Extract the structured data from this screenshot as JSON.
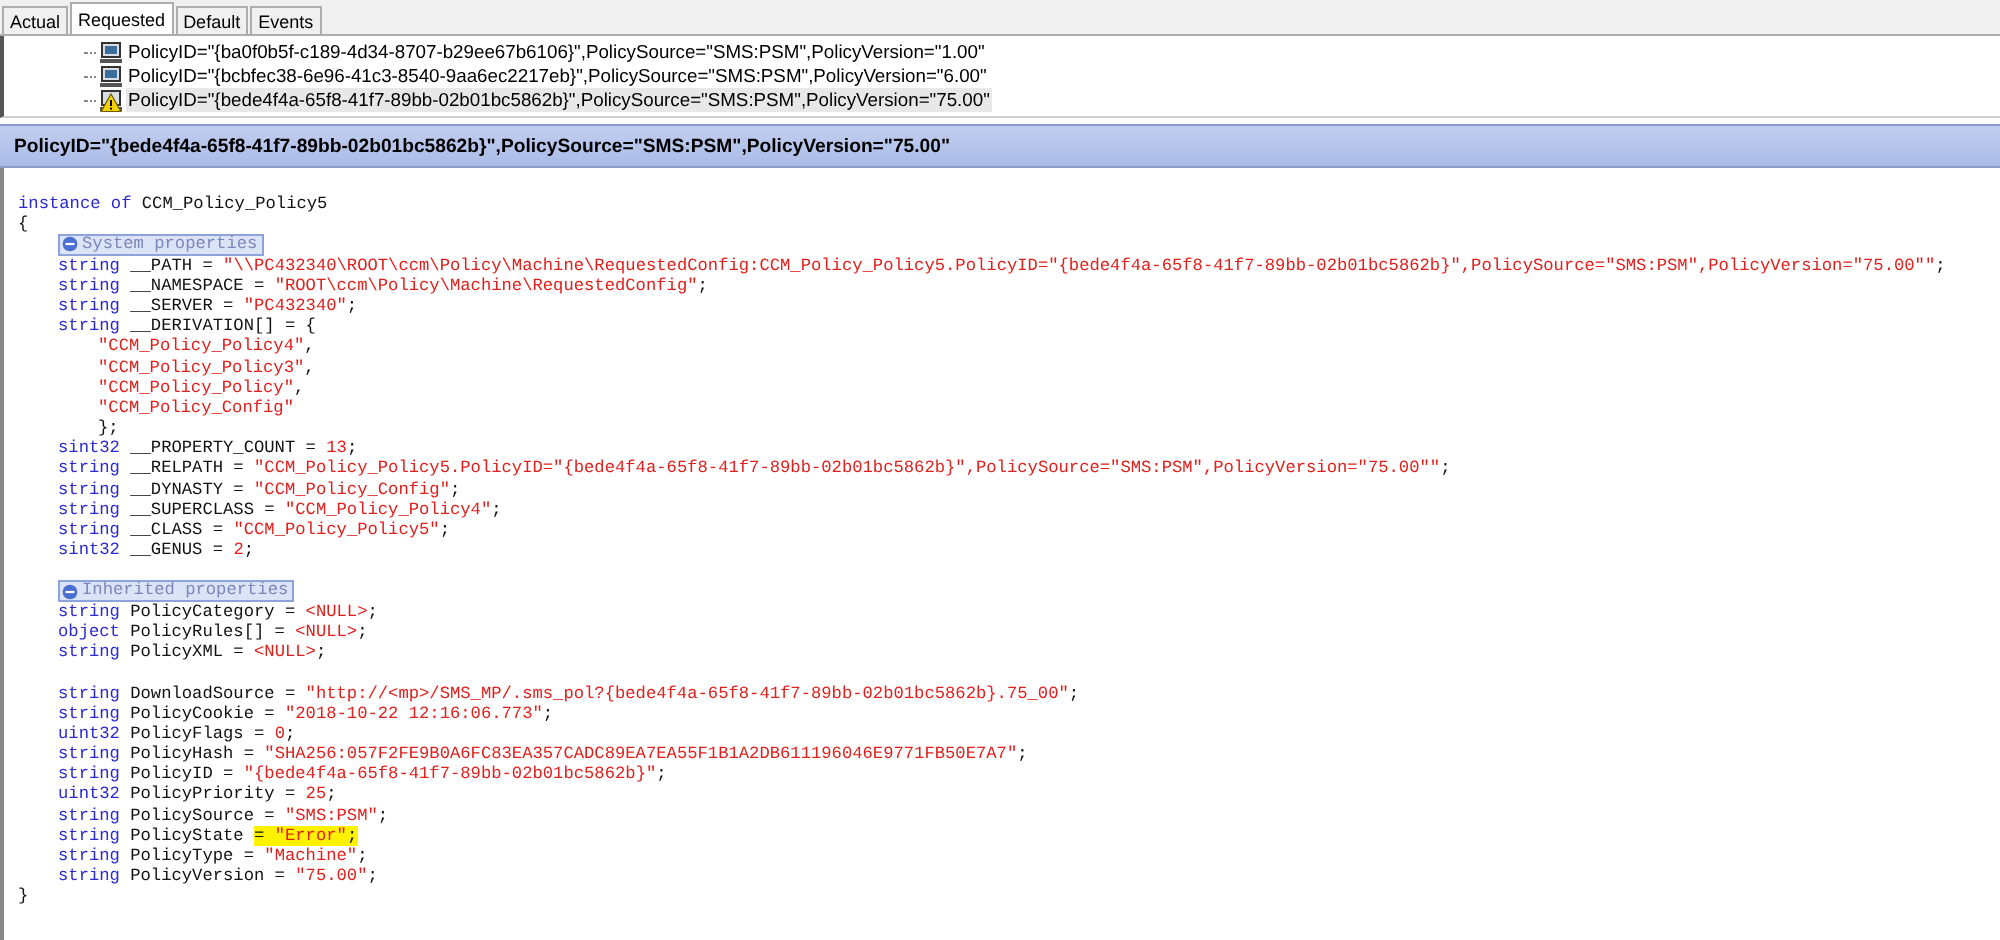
{
  "tabs": [
    {
      "label": "Actual",
      "selected": false
    },
    {
      "label": "Requested",
      "selected": true
    },
    {
      "label": "Default",
      "selected": false
    },
    {
      "label": "Events",
      "selected": false
    }
  ],
  "tree": {
    "items": [
      {
        "kind": "computer",
        "label": "PolicyID=\"{ba0f0b5f-c189-4d34-8707-b29ee67b6106}\",PolicySource=\"SMS:PSM\",PolicyVersion=\"1.00\"",
        "selected": false
      },
      {
        "kind": "computer",
        "label": "PolicyID=\"{bcbfec38-6e96-41c3-8540-9aa6ec2217eb}\",PolicySource=\"SMS:PSM\",PolicyVersion=\"6.00\"",
        "selected": false
      },
      {
        "kind": "warning",
        "label": "PolicyID=\"{bede4f4a-65f8-41f7-89bb-02b01bc5862b}\",PolicySource=\"SMS:PSM\",PolicyVersion=\"75.00\"",
        "selected": true
      }
    ]
  },
  "title_bar": {
    "title": "PolicyID=\"{bede4f4a-65f8-41f7-89bb-02b01bc5862b}\",PolicySource=\"SMS:PSM\",PolicyVersion=\"75.00\""
  },
  "code": {
    "lines": [
      {
        "kind": "code",
        "tokens": [
          {
            "kind": "keyword",
            "text": "instance of"
          },
          {
            "kind": "plain",
            "text": " CCM_Policy_Policy5"
          }
        ]
      },
      {
        "kind": "code",
        "tokens": [
          {
            "kind": "plain",
            "text": "{"
          }
        ]
      },
      {
        "kind": "section",
        "label": "System properties",
        "expanded": true,
        "children": [
          {
            "kind": "code",
            "tokens": [
              {
                "kind": "keyword",
                "text": "string"
              },
              {
                "kind": "plain",
                "text": " __PATH = "
              },
              {
                "kind": "literal",
                "text": "\"\\\\PC432340\\ROOT\\ccm\\Policy\\Machine\\RequestedConfig:CCM_Policy_Policy5.PolicyID=\"{bede4f4a-65f8-41f7-89bb-02b01bc5862b}\",PolicySource=\"SMS:PSM\",PolicyVersion=\"75.00\"\""
              },
              {
                "kind": "plain",
                "text": ";"
              }
            ]
          },
          {
            "kind": "code",
            "tokens": [
              {
                "kind": "keyword",
                "text": "string"
              },
              {
                "kind": "plain",
                "text": " __NAMESPACE = "
              },
              {
                "kind": "literal",
                "text": "\"ROOT\\ccm\\Policy\\Machine\\RequestedConfig\""
              },
              {
                "kind": "plain",
                "text": ";"
              }
            ]
          },
          {
            "kind": "code",
            "tokens": [
              {
                "kind": "keyword",
                "text": "string"
              },
              {
                "kind": "plain",
                "text": " __SERVER = "
              },
              {
                "kind": "literal",
                "text": "\"PC432340\""
              },
              {
                "kind": "plain",
                "text": ";"
              }
            ]
          },
          {
            "kind": "code",
            "tokens": [
              {
                "kind": "keyword",
                "text": "string"
              },
              {
                "kind": "plain",
                "text": " __DERIVATION[] = {"
              }
            ],
            "children": [
              {
                "kind": "code",
                "tokens": [
                  {
                    "kind": "literal",
                    "text": "\"CCM_Policy_Policy4\""
                  },
                  {
                    "kind": "plain",
                    "text": ","
                  }
                ]
              },
              {
                "kind": "code",
                "tokens": [
                  {
                    "kind": "literal",
                    "text": "\"CCM_Policy_Policy3\""
                  },
                  {
                    "kind": "plain",
                    "text": ","
                  }
                ]
              },
              {
                "kind": "code",
                "tokens": [
                  {
                    "kind": "literal",
                    "text": "\"CCM_Policy_Policy\""
                  },
                  {
                    "kind": "plain",
                    "text": ","
                  }
                ]
              },
              {
                "kind": "code",
                "tokens": [
                  {
                    "kind": "literal",
                    "text": "\"CCM_Policy_Config\""
                  }
                ]
              },
              {
                "kind": "code",
                "tokens": [
                  {
                    "kind": "plain",
                    "text": "};"
                  }
                ]
              }
            ]
          },
          {
            "kind": "code",
            "tokens": [
              {
                "kind": "keyword",
                "text": "sint32"
              },
              {
                "kind": "plain",
                "text": " __PROPERTY_COUNT = "
              },
              {
                "kind": "literal",
                "text": "13"
              },
              {
                "kind": "plain",
                "text": ";"
              }
            ]
          },
          {
            "kind": "code",
            "tokens": [
              {
                "kind": "keyword",
                "text": "string"
              },
              {
                "kind": "plain",
                "text": " __RELPATH = "
              },
              {
                "kind": "literal",
                "text": "\"CCM_Policy_Policy5.PolicyID=\"{bede4f4a-65f8-41f7-89bb-02b01bc5862b}\",PolicySource=\"SMS:PSM\",PolicyVersion=\"75.00\"\""
              },
              {
                "kind": "plain",
                "text": ";"
              }
            ]
          },
          {
            "kind": "code",
            "tokens": [
              {
                "kind": "keyword",
                "text": "string"
              },
              {
                "kind": "plain",
                "text": " __DYNASTY = "
              },
              {
                "kind": "literal",
                "text": "\"CCM_Policy_Config\""
              },
              {
                "kind": "plain",
                "text": ";"
              }
            ]
          },
          {
            "kind": "code",
            "tokens": [
              {
                "kind": "keyword",
                "text": "string"
              },
              {
                "kind": "plain",
                "text": " __SUPERCLASS = "
              },
              {
                "kind": "literal",
                "text": "\"CCM_Policy_Policy4\""
              },
              {
                "kind": "plain",
                "text": ";"
              }
            ]
          },
          {
            "kind": "code",
            "tokens": [
              {
                "kind": "keyword",
                "text": "string"
              },
              {
                "kind": "plain",
                "text": " __CLASS = "
              },
              {
                "kind": "literal",
                "text": "\"CCM_Policy_Policy5\""
              },
              {
                "kind": "plain",
                "text": ";"
              }
            ]
          },
          {
            "kind": "code",
            "tokens": [
              {
                "kind": "keyword",
                "text": "sint32"
              },
              {
                "kind": "plain",
                "text": " __GENUS = "
              },
              {
                "kind": "literal",
                "text": "2"
              },
              {
                "kind": "plain",
                "text": ";"
              }
            ]
          }
        ]
      },
      {
        "kind": "blank"
      },
      {
        "kind": "section",
        "label": "Inherited properties",
        "expanded": true,
        "children": [
          {
            "kind": "code",
            "tokens": [
              {
                "kind": "keyword",
                "text": "string"
              },
              {
                "kind": "plain",
                "text": " PolicyCategory = "
              },
              {
                "kind": "literal",
                "text": "<NULL>"
              },
              {
                "kind": "plain",
                "text": ";"
              }
            ]
          },
          {
            "kind": "code",
            "tokens": [
              {
                "kind": "keyword",
                "text": "object"
              },
              {
                "kind": "plain",
                "text": " PolicyRules[] = "
              },
              {
                "kind": "literal",
                "text": "<NULL>"
              },
              {
                "kind": "plain",
                "text": ";"
              }
            ]
          },
          {
            "kind": "code",
            "tokens": [
              {
                "kind": "keyword",
                "text": "string"
              },
              {
                "kind": "plain",
                "text": " PolicyXML = "
              },
              {
                "kind": "literal",
                "text": "<NULL>"
              },
              {
                "kind": "plain",
                "text": ";"
              }
            ]
          },
          {
            "kind": "blank"
          },
          {
            "kind": "code",
            "tokens": [
              {
                "kind": "keyword",
                "text": "string"
              },
              {
                "kind": "plain",
                "text": " DownloadSource = "
              },
              {
                "kind": "literal",
                "text": "\"http://<mp>/SMS_MP/.sms_pol?{bede4f4a-65f8-41f7-89bb-02b01bc5862b}.75_00\""
              },
              {
                "kind": "plain",
                "text": ";"
              }
            ]
          },
          {
            "kind": "code",
            "tokens": [
              {
                "kind": "keyword",
                "text": "string"
              },
              {
                "kind": "plain",
                "text": " PolicyCookie = "
              },
              {
                "kind": "literal",
                "text": "\"2018-10-22 12:16:06.773\""
              },
              {
                "kind": "plain",
                "text": ";"
              }
            ]
          },
          {
            "kind": "code",
            "tokens": [
              {
                "kind": "keyword",
                "text": "uint32"
              },
              {
                "kind": "plain",
                "text": " PolicyFlags = "
              },
              {
                "kind": "literal",
                "text": "0"
              },
              {
                "kind": "plain",
                "text": ";"
              }
            ]
          },
          {
            "kind": "code",
            "tokens": [
              {
                "kind": "keyword",
                "text": "string"
              },
              {
                "kind": "plain",
                "text": " PolicyHash = "
              },
              {
                "kind": "literal",
                "text": "\"SHA256:057F2FE9B0A6FC83EA357CADC89EA7EA55F1B1A2DB611196046E9771FB50E7A7\""
              },
              {
                "kind": "plain",
                "text": ";"
              }
            ]
          },
          {
            "kind": "code",
            "tokens": [
              {
                "kind": "keyword",
                "text": "string"
              },
              {
                "kind": "plain",
                "text": " PolicyID = "
              },
              {
                "kind": "literal",
                "text": "\"{bede4f4a-65f8-41f7-89bb-02b01bc5862b}\""
              },
              {
                "kind": "plain",
                "text": ";"
              }
            ]
          },
          {
            "kind": "code",
            "tokens": [
              {
                "kind": "keyword",
                "text": "uint32"
              },
              {
                "kind": "plain",
                "text": " PolicyPriority = "
              },
              {
                "kind": "literal",
                "text": "25"
              },
              {
                "kind": "plain",
                "text": ";"
              }
            ]
          },
          {
            "kind": "code",
            "tokens": [
              {
                "kind": "keyword",
                "text": "string"
              },
              {
                "kind": "plain",
                "text": " PolicySource = "
              },
              {
                "kind": "literal",
                "text": "\"SMS:PSM\""
              },
              {
                "kind": "plain",
                "text": ";"
              }
            ]
          },
          {
            "kind": "code",
            "tokens": [
              {
                "kind": "keyword",
                "text": "string"
              },
              {
                "kind": "plain",
                "text": " PolicyState "
              },
              {
                "kind": "mark",
                "tokens": [
                  {
                    "kind": "plain",
                    "text": "= "
                  },
                  {
                    "kind": "literal",
                    "text": "\"Error\""
                  },
                  {
                    "kind": "plain",
                    "text": ";"
                  }
                ]
              }
            ]
          },
          {
            "kind": "code",
            "tokens": [
              {
                "kind": "keyword",
                "text": "string"
              },
              {
                "kind": "plain",
                "text": " PolicyType = "
              },
              {
                "kind": "literal",
                "text": "\"Machine\""
              },
              {
                "kind": "plain",
                "text": ";"
              }
            ]
          },
          {
            "kind": "code",
            "tokens": [
              {
                "kind": "keyword",
                "text": "string"
              },
              {
                "kind": "plain",
                "text": " PolicyVersion = "
              },
              {
                "kind": "literal",
                "text": "\"75.00\""
              },
              {
                "kind": "plain",
                "text": ";"
              }
            ]
          }
        ]
      },
      {
        "kind": "code",
        "tokens": [
          {
            "kind": "plain",
            "text": "}"
          }
        ]
      }
    ]
  }
}
